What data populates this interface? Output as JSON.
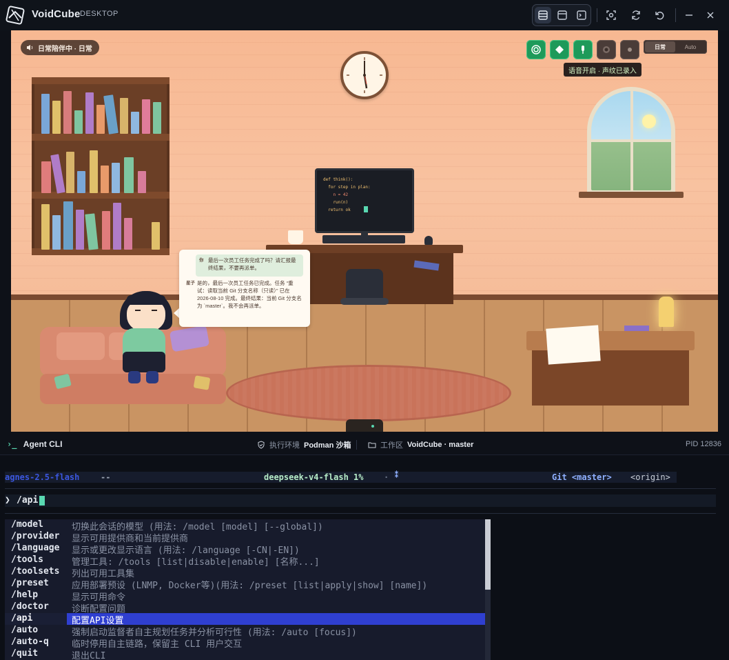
{
  "titlebar": {
    "app_name": "VoidCube",
    "app_sub": "DESKTOP"
  },
  "scene": {
    "status_pill": "日常陪伴中 · 日常",
    "mode_toggle": [
      "日常",
      "Auto"
    ],
    "voice_tip": "语音开启 · 声纹已录入",
    "monitor_code": [
      "def think():",
      "  for step in plan:",
      "    n = 42",
      "    run(n)",
      "  return ok"
    ],
    "chat": {
      "user_label": "你",
      "user_text": "最后一次员工任务完成了吗？请汇报最终结果，不要再派单。",
      "agent_label": "星子",
      "agent_text": "是的，最后一次员工任务已完成。任务 “重试：读取当前 Git 分支名称（只读）” 已在 2026-08-10 完成。最终结果：当前 Git 分支名为 `master`。我不会再派单。"
    }
  },
  "cli": {
    "title": "Agent CLI",
    "env_label": "执行环境",
    "env_value": "Podman 沙箱",
    "ws_label": "工作区",
    "ws_value": "VoidCube · master",
    "pid": "PID 12836"
  },
  "terminal": {
    "status": {
      "agent": "agnes-2.5-flash",
      "agent_sep": "--",
      "model": "deepseek-v4-flash 1%",
      "dot": "·",
      "git": "Git <master>",
      "origin": "<origin>"
    },
    "prompt_symbol": "❯",
    "prompt_text": "/api",
    "commands": [
      {
        "cmd": "/model",
        "desc": "切换此会话的模型 (用法: /model [model] [--global])"
      },
      {
        "cmd": "/provider",
        "desc": "显示可用提供商和当前提供商"
      },
      {
        "cmd": "/language",
        "desc": "显示或更改显示语言 (用法: /language [-CN|-EN])"
      },
      {
        "cmd": "/tools",
        "desc": "管理工具: /tools [list|disable|enable] [名称...]"
      },
      {
        "cmd": "/toolsets",
        "desc": "列出可用工具集"
      },
      {
        "cmd": "/preset",
        "desc": "应用部署预设 (LNMP, Docker等)(用法: /preset [list|apply|show] [name])"
      },
      {
        "cmd": "/help",
        "desc": "显示可用命令"
      },
      {
        "cmd": "/doctor",
        "desc": "诊断配置问题"
      },
      {
        "cmd": "/api",
        "desc": "配置API设置"
      },
      {
        "cmd": "/auto",
        "desc": "强制启动监督者自主规划任务并分析可行性 (用法: /auto [focus])"
      },
      {
        "cmd": "/auto-q",
        "desc": "临时停用自主链路，保留主 CLI 用户交互"
      },
      {
        "cmd": "/quit",
        "desc": "退出CLI"
      }
    ],
    "selected_index": 8
  },
  "colors": {
    "accent_green": "#1e9a5a",
    "selection": "#2f3fd0",
    "agent_name": "#3b57e0",
    "model_name": "#b6ecc8",
    "git": "#8fb0ff"
  }
}
